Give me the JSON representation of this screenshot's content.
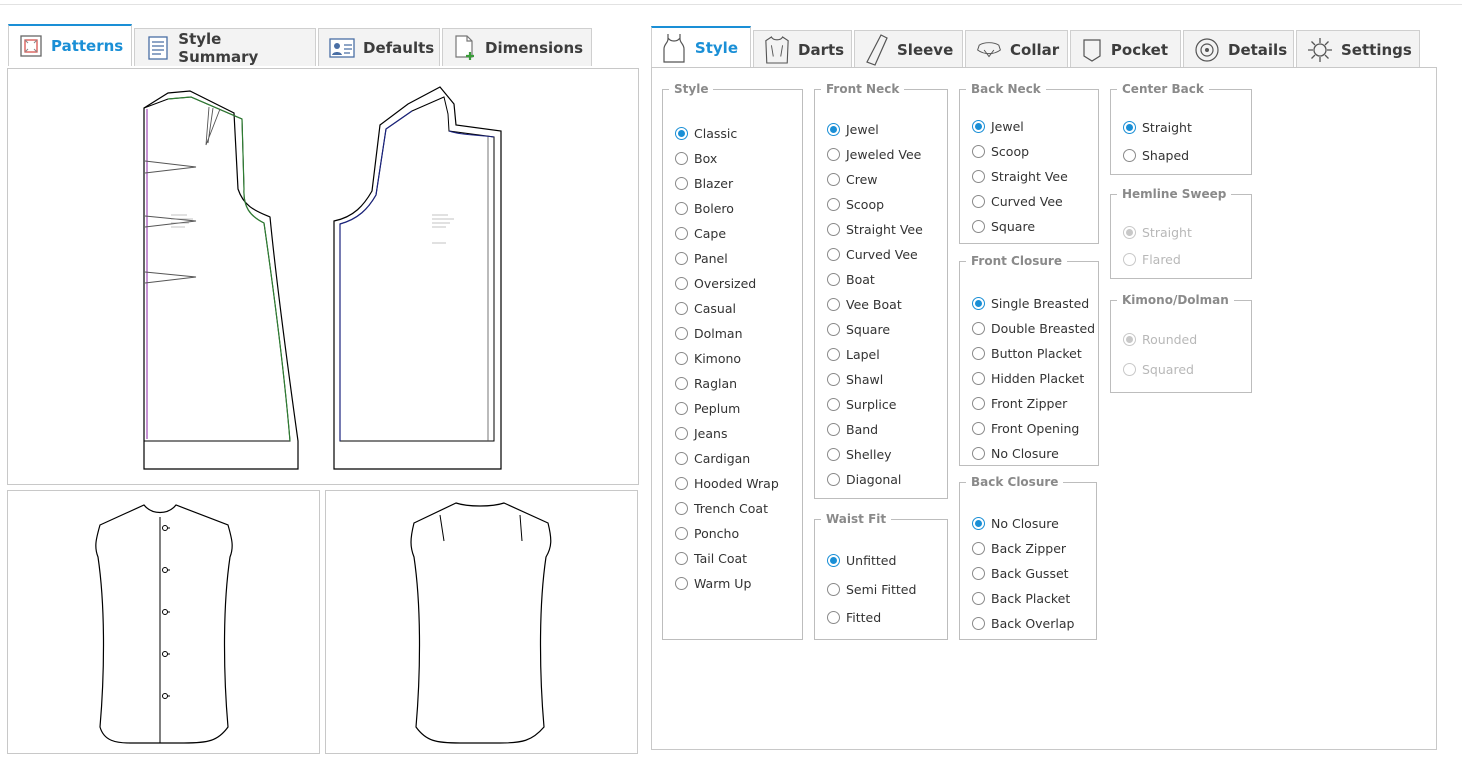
{
  "left_tabs": [
    {
      "label": "Patterns",
      "icon": "patterns-icon",
      "active": true
    },
    {
      "label": "Style Summary",
      "icon": "style-summary-icon",
      "active": false
    },
    {
      "label": "Defaults",
      "icon": "defaults-icon",
      "active": false
    },
    {
      "label": "Dimensions",
      "icon": "dimensions-icon",
      "active": false
    }
  ],
  "right_tabs": [
    {
      "label": "Style",
      "icon": "tank-top-icon",
      "active": true
    },
    {
      "label": "Darts",
      "icon": "darts-icon",
      "active": false
    },
    {
      "label": "Sleeve",
      "icon": "sleeve-icon",
      "active": false
    },
    {
      "label": "Collar",
      "icon": "collar-icon",
      "active": false
    },
    {
      "label": "Pocket",
      "icon": "pocket-icon",
      "active": false
    },
    {
      "label": "Details",
      "icon": "details-icon",
      "active": false
    },
    {
      "label": "Settings",
      "icon": "gear-icon",
      "active": false
    }
  ],
  "groups": {
    "style": {
      "legend": "Style",
      "selected": "Classic",
      "options": [
        "Classic",
        "Box",
        "Blazer",
        "Bolero",
        "Cape",
        "Panel",
        "Oversized",
        "Casual",
        "Dolman",
        "Kimono",
        "Raglan",
        "Peplum",
        "Jeans",
        "Cardigan",
        "Hooded Wrap",
        "Trench Coat",
        "Poncho",
        "Tail Coat",
        "Warm Up"
      ]
    },
    "front_neck": {
      "legend": "Front Neck",
      "selected": "Jewel",
      "options": [
        "Jewel",
        "Jeweled Vee",
        "Crew",
        "Scoop",
        "Straight Vee",
        "Curved Vee",
        "Boat",
        "Vee Boat",
        "Square",
        "Lapel",
        "Shawl",
        "Surplice",
        "Band",
        "Shelley",
        "Diagonal"
      ]
    },
    "waist_fit": {
      "legend": "Waist Fit",
      "selected": "Unfitted",
      "options": [
        "Unfitted",
        "Semi Fitted",
        "Fitted"
      ]
    },
    "back_neck": {
      "legend": "Back Neck",
      "selected": "Jewel",
      "options": [
        "Jewel",
        "Scoop",
        "Straight Vee",
        "Curved Vee",
        "Square"
      ]
    },
    "front_closure": {
      "legend": "Front Closure",
      "selected": "Single Breasted",
      "options": [
        "Single Breasted",
        "Double Breasted",
        "Button Placket",
        "Hidden Placket",
        "Front Zipper",
        "Front Opening",
        "No Closure"
      ]
    },
    "back_closure": {
      "legend": "Back Closure",
      "selected": "No Closure",
      "options": [
        "No Closure",
        "Back Zipper",
        "Back Gusset",
        "Back Placket",
        "Back Overlap"
      ]
    },
    "center_back": {
      "legend": "Center Back",
      "selected": "Straight",
      "options": [
        "Straight",
        "Shaped"
      ]
    },
    "hemline_sweep": {
      "legend": "Hemline Sweep",
      "selected": "Straight",
      "disabled": true,
      "options": [
        "Straight",
        "Flared"
      ]
    },
    "kimono_dolman": {
      "legend": "Kimono/Dolman",
      "selected": "Rounded",
      "disabled": true,
      "options": [
        "Rounded",
        "Squared"
      ]
    }
  },
  "colors": {
    "accent": "#1a8fd6",
    "front_seam": "#2e7d32",
    "back_seam": "#1a237e",
    "center_line": "#8e24aa"
  }
}
